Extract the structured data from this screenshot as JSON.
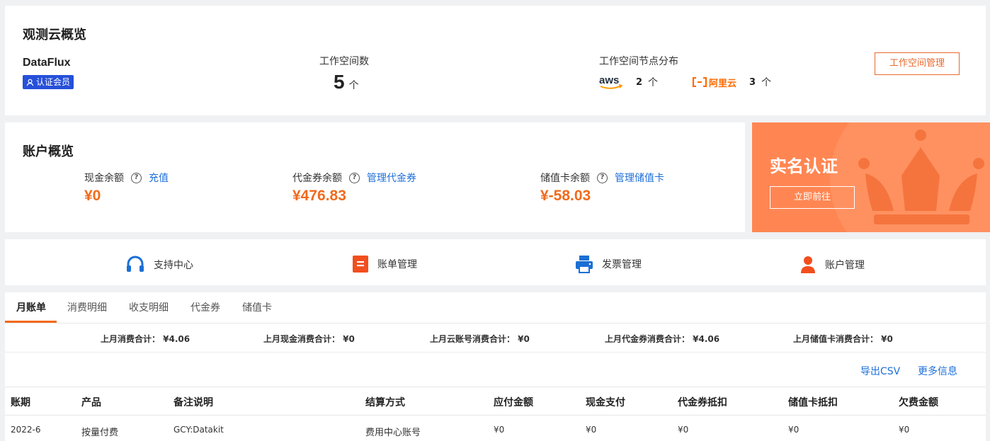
{
  "overview": {
    "title": "观测云概览",
    "org_name": "DataFlux",
    "badge": "认证会员",
    "workspace_count_label": "工作空间数",
    "workspace_count": "5",
    "unit": "个",
    "distribution_label": "工作空间节点分布",
    "providers": [
      {
        "name": "aws",
        "count": "2",
        "unit": "个"
      },
      {
        "name": "阿里云",
        "count": "3",
        "unit": "个"
      }
    ],
    "manage_button": "工作空间管理"
  },
  "account": {
    "title": "账户概览",
    "cash": {
      "label": "现金余额",
      "value": "¥0",
      "action": "充值"
    },
    "voucher": {
      "label": "代金券余额",
      "value": "¥476.83",
      "action": "管理代金券"
    },
    "stored": {
      "label": "储值卡余额",
      "value": "¥-58.03",
      "action": "管理储值卡"
    },
    "help_glyph": "?"
  },
  "verify": {
    "title": "实名认证",
    "button": "立即前往"
  },
  "nav": [
    {
      "label": "支持中心",
      "icon": "headset-icon"
    },
    {
      "label": "账单管理",
      "icon": "bill-icon"
    },
    {
      "label": "发票管理",
      "icon": "printer-icon"
    },
    {
      "label": "账户管理",
      "icon": "user-icon"
    }
  ],
  "tabs": [
    "月账单",
    "消费明细",
    "收支明细",
    "代金券",
    "储值卡"
  ],
  "active_tab": "月账单",
  "summary": [
    "上月消费合计：  ¥4.06",
    "上月现金消费合计：  ¥0",
    "上月云账号消费合计：  ¥0",
    "上月代金券消费合计：  ¥4.06",
    "上月储值卡消费合计：  ¥0"
  ],
  "actions": {
    "export": "导出CSV",
    "more": "更多信息"
  },
  "table": {
    "columns": [
      "账期",
      "产品",
      "备注说明",
      "结算方式",
      "应付金额",
      "现金支付",
      "代金券抵扣",
      "储值卡抵扣",
      "欠费金额"
    ],
    "rows": [
      [
        "2022-6",
        "按量付费",
        "GCY:Datakit",
        "费用中心账号",
        "¥0",
        "¥0",
        "¥0",
        "¥0",
        "¥0"
      ]
    ]
  },
  "colors": {
    "accent": "#f26a1b",
    "link": "#1e6fd9",
    "badge": "#2650d9",
    "verify_bg": "#ff8652"
  }
}
